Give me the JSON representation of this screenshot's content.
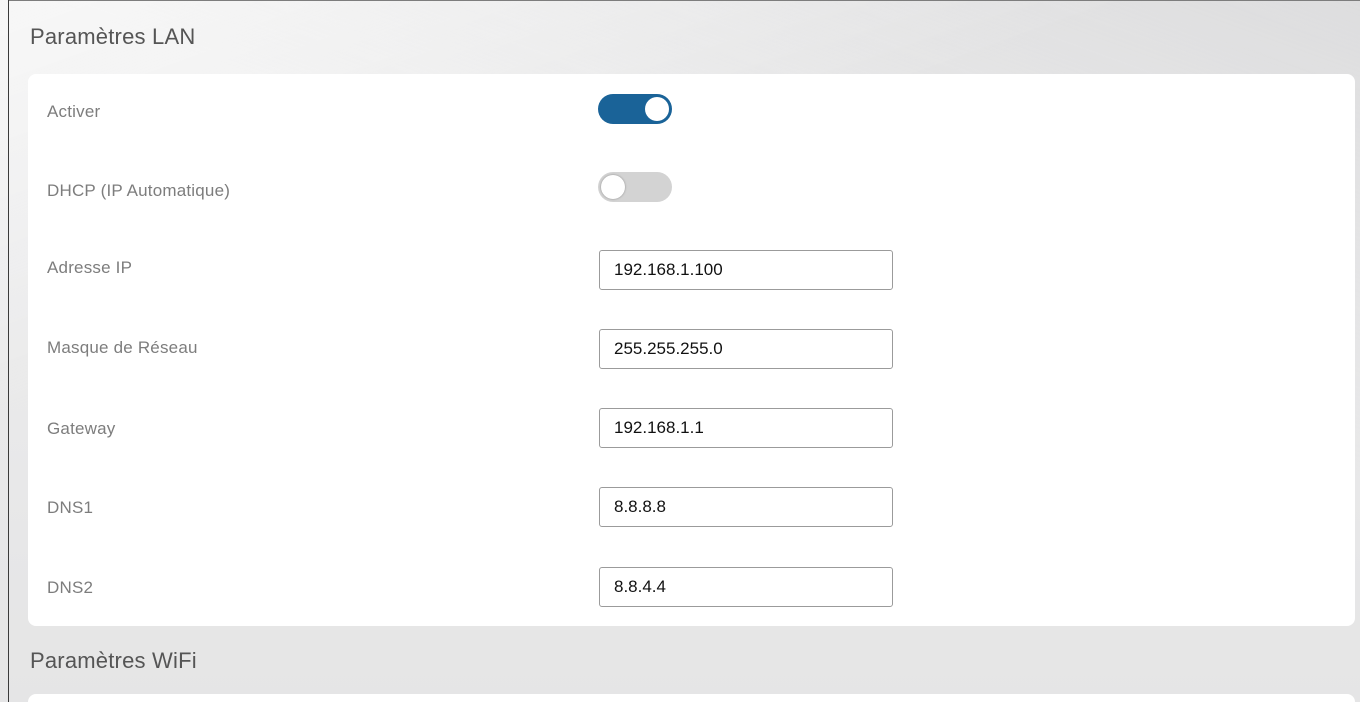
{
  "lan_section": {
    "title": "Paramètres LAN",
    "enable": {
      "label": "Activer",
      "state": "on"
    },
    "dhcp": {
      "label": "DHCP (IP Automatique)",
      "state": "off"
    },
    "ip_address": {
      "label": "Adresse IP",
      "value": "192.168.1.100"
    },
    "netmask": {
      "label": "Masque de Réseau",
      "value": "255.255.255.0"
    },
    "gateway": {
      "label": "Gateway",
      "value": "192.168.1.1"
    },
    "dns1": {
      "label": "DNS1",
      "value": "8.8.8.8"
    },
    "dns2": {
      "label": "DNS2",
      "value": "8.8.4.4"
    }
  },
  "wifi_section": {
    "title": "Paramètres WiFi"
  },
  "colors": {
    "toggle_on": "#1a6398",
    "toggle_off": "#d3d3d3",
    "label_text": "#7d7d7d",
    "section_title": "#555555"
  }
}
